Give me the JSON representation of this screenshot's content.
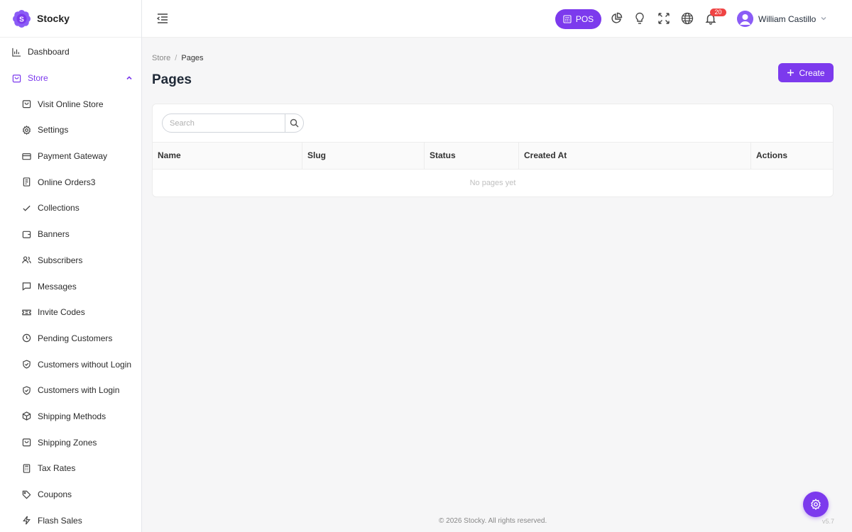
{
  "colors": {
    "accent": "#7c3aed",
    "badge": "#ef4444"
  },
  "brand": {
    "name": "Stocky",
    "logo_letter": "S"
  },
  "sidebar": {
    "items": [
      {
        "label": "Dashboard",
        "icon": "bar-chart-icon",
        "level": "top",
        "active": false
      },
      {
        "label": "Store",
        "icon": "shopping-bag-icon",
        "level": "top",
        "active": true,
        "expanded": true
      },
      {
        "label": "Visit Online Store",
        "icon": "shopping-bag-icon",
        "level": "sub"
      },
      {
        "label": "Settings",
        "icon": "gear-icon",
        "level": "sub"
      },
      {
        "label": "Payment Gateway",
        "icon": "credit-card-icon",
        "level": "sub"
      },
      {
        "label": "Online Orders3",
        "icon": "receipt-icon",
        "level": "sub"
      },
      {
        "label": "Collections",
        "icon": "check-icon",
        "level": "sub"
      },
      {
        "label": "Banners",
        "icon": "wallet-icon",
        "level": "sub"
      },
      {
        "label": "Subscribers",
        "icon": "users-icon",
        "level": "sub"
      },
      {
        "label": "Messages",
        "icon": "message-icon",
        "level": "sub"
      },
      {
        "label": "Invite Codes",
        "icon": "ticket-icon",
        "level": "sub"
      },
      {
        "label": "Pending Customers",
        "icon": "clock-icon",
        "level": "sub"
      },
      {
        "label": "Customers without Login",
        "icon": "shield-check-icon",
        "level": "sub"
      },
      {
        "label": "Customers with Login",
        "icon": "shield-check-icon",
        "level": "sub"
      },
      {
        "label": "Shipping Methods",
        "icon": "package-icon",
        "level": "sub"
      },
      {
        "label": "Shipping Zones",
        "icon": "shopping-bag-icon",
        "level": "sub"
      },
      {
        "label": "Tax Rates",
        "icon": "calculator-icon",
        "level": "sub"
      },
      {
        "label": "Coupons",
        "icon": "tag-icon",
        "level": "sub"
      },
      {
        "label": "Flash Sales",
        "icon": "lightning-icon",
        "level": "sub"
      }
    ]
  },
  "topbar": {
    "pos_label": "POS",
    "notification_count": "20",
    "user_name": "William Castillo"
  },
  "breadcrumb": {
    "parent": "Store",
    "separator": "/",
    "current": "Pages"
  },
  "page": {
    "title": "Pages",
    "create_label": "Create"
  },
  "search": {
    "placeholder": "Search",
    "value": ""
  },
  "table": {
    "columns": [
      "Name",
      "Slug",
      "Status",
      "Created At",
      "Actions"
    ],
    "empty_text": "No pages yet"
  },
  "footer": {
    "copyright": "© 2026 Stocky. All rights reserved.",
    "version": "v5.7"
  }
}
